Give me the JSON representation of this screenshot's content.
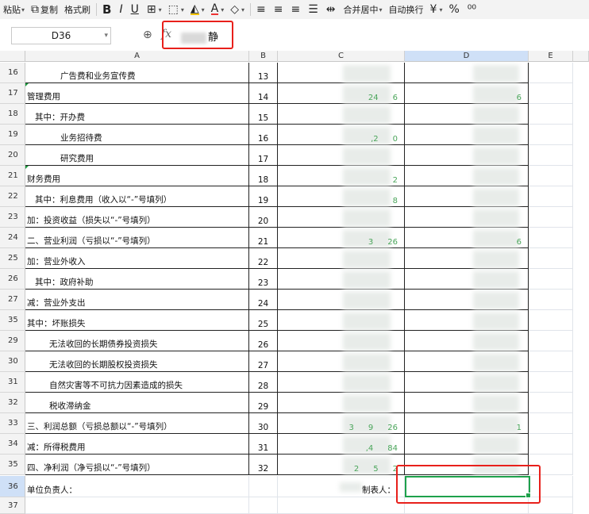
{
  "toolbar": {
    "paste": "粘贴",
    "copy": "复制",
    "format_painter": "格式刷",
    "bold": "B",
    "italic": "I",
    "underline": "U",
    "merge_center": "合并居中",
    "wrap_text": "自动换行",
    "currency": "¥",
    "percent": "%"
  },
  "formula_bar": {
    "name_box": "D36",
    "fx": "fx",
    "value_visible": "静"
  },
  "columns": [
    "A",
    "B",
    "C",
    "D",
    "E"
  ],
  "rows": [
    {
      "num": "16",
      "a": "广告费和业务宣传费",
      "indent": 3,
      "b": "13",
      "c": "",
      "d": ""
    },
    {
      "num": "17",
      "a": "管理费用",
      "indent": 0,
      "b": "14",
      "c": "24",
      "c2": "6",
      "d": "6"
    },
    {
      "num": "18",
      "a": "其中：开办费",
      "indent": 1,
      "b": "15",
      "c": "",
      "d": ""
    },
    {
      "num": "19",
      "a": "业务招待费",
      "indent": 3,
      "b": "16",
      "c": ",2",
      "c2": "0",
      "d": ""
    },
    {
      "num": "20",
      "a": "研究费用",
      "indent": 3,
      "b": "17",
      "c": "",
      "d": ""
    },
    {
      "num": "21",
      "a": "财务费用",
      "indent": 0,
      "b": "18",
      "c": "2",
      "d": ""
    },
    {
      "num": "22",
      "a": "其中：利息费用（收入以“-”号填列）",
      "indent": 1,
      "b": "19",
      "c": "8",
      "d": ""
    },
    {
      "num": "23",
      "a": "加：投资收益（损失以“-”号填列）",
      "indent": 0,
      "b": "20",
      "c": "",
      "d": ""
    },
    {
      "num": "24",
      "a": "二、营业利润（亏损以“-”号填列）",
      "indent": 0,
      "b": "21",
      "c": "3",
      "c2": "26",
      "d": "6"
    },
    {
      "num": "25",
      "a": "加：营业外收入",
      "indent": 0,
      "b": "22",
      "c": "",
      "d": ""
    },
    {
      "num": "26",
      "a": "其中：政府补助",
      "indent": 1,
      "b": "23",
      "c": "",
      "d": ""
    },
    {
      "num": "27",
      "a": "减：营业外支出",
      "indent": 0,
      "b": "24",
      "c": "",
      "d": ""
    },
    {
      "num": "35",
      "a": "其中：坏账损失",
      "indent": 0,
      "b": "25",
      "c": "",
      "d": ""
    },
    {
      "num": "29",
      "a": "无法收回的长期债券投资损失",
      "indent": 2,
      "b": "26",
      "c": "",
      "d": ""
    },
    {
      "num": "30",
      "a": "无法收回的长期股权投资损失",
      "indent": 2,
      "b": "27",
      "c": "",
      "d": ""
    },
    {
      "num": "31",
      "a": "自然灾害等不可抗力因素造成的损失",
      "indent": 2,
      "b": "28",
      "c": "",
      "d": ""
    },
    {
      "num": "32",
      "a": "税收滞纳金",
      "indent": 2,
      "b": "29",
      "c": "",
      "d": ""
    },
    {
      "num": "33",
      "a": "三、利润总额（亏损总额以“-”号填列）",
      "indent": 0,
      "b": "30",
      "c": "3",
      "c2": "9",
      "c3": "26",
      "d": "1"
    },
    {
      "num": "34",
      "a": "减：所得税费用",
      "indent": 0,
      "b": "31",
      "c": ",4",
      "c2": "84",
      "d": ""
    },
    {
      "num": "35",
      "a": "四、净利润（净亏损以“-”号填列）",
      "indent": 0,
      "b": "32",
      "c": "2",
      "c2": "5",
      "c3": "2",
      "d": ""
    }
  ],
  "footer_row": {
    "num": "36",
    "a": "单位负责人：",
    "c": "制表人："
  },
  "last_row": {
    "num": "37"
  },
  "colors": {
    "accent_green": "#1ea14b",
    "highlight_red": "#e8201b",
    "number_green": "#4aa55a"
  }
}
